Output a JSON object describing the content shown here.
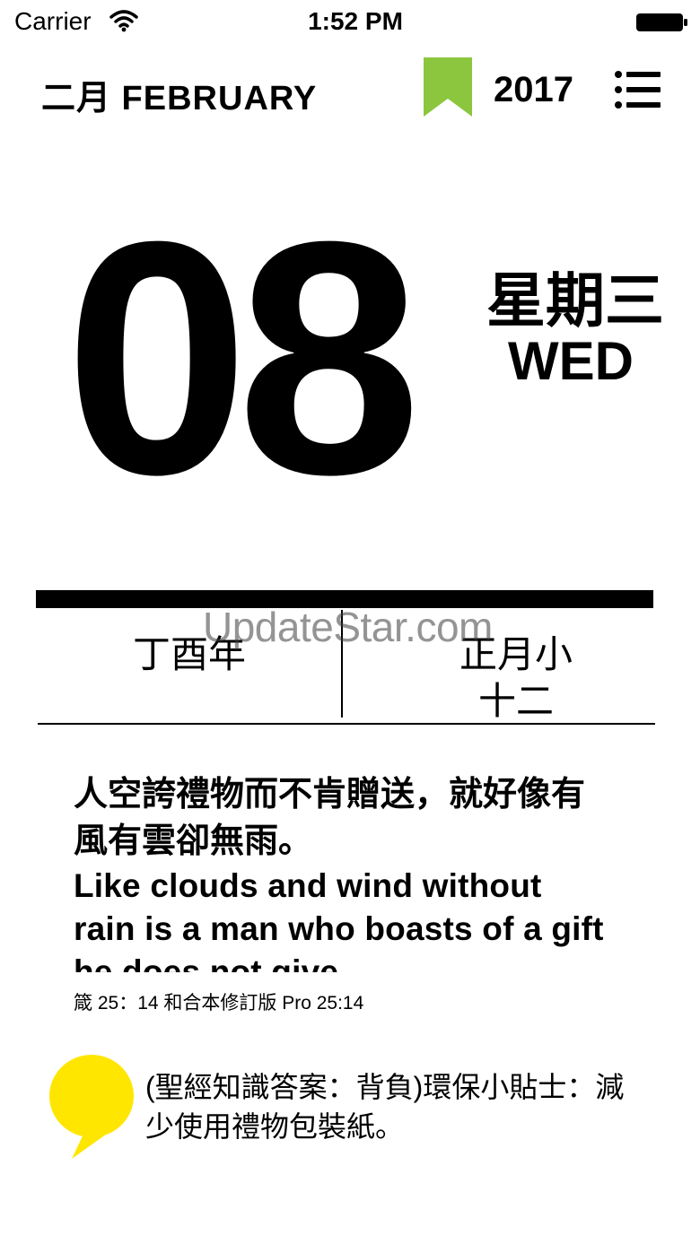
{
  "status_bar": {
    "carrier": "Carrier",
    "time": "1:52 PM",
    "icons": [
      "wifi-icon",
      "battery-icon"
    ]
  },
  "header": {
    "month": "二月 FEBRUARY",
    "year": "2017",
    "bookmark_color": "#8cc63f",
    "icons": [
      "bookmark-icon",
      "menu-icon"
    ]
  },
  "date": {
    "day": "08",
    "weekday_zh": "星期三",
    "weekday_en": "WED"
  },
  "lunar": {
    "ganzhi_year": "丁酉年",
    "month": "正月小",
    "day": "十二"
  },
  "quote": {
    "zh": "人空誇禮物而不肯贈送，就好像有風有雲卻無雨。",
    "en": "Like clouds and wind without rain is a man who boasts of a gift he does not give.",
    "reference": "箴 25：14 和合本修訂版 Pro 25:14"
  },
  "tip": {
    "text": "(聖經知識答案：背負)環保小貼士：減少使用禮物包裝紙。",
    "bubble_color": "#ffe600",
    "icon": "speech-bubble-icon"
  },
  "watermark": "UpdateStar.com"
}
